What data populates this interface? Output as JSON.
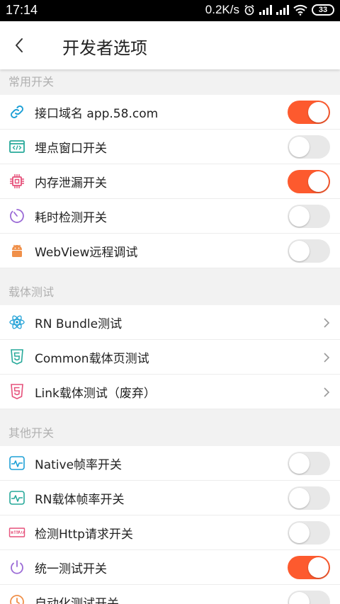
{
  "status_bar": {
    "time": "17:14",
    "network_speed": "0.2K/s",
    "battery": "33"
  },
  "header": {
    "title": "开发者选项",
    "back_icon": "chevron-left-icon"
  },
  "colors": {
    "accent": "#fd5a2e",
    "toggle_off": "#e8e8e8",
    "section_text": "#b0b0b0"
  },
  "sections": [
    {
      "title": "常用开关",
      "items": [
        {
          "label": "接口域名 app.58.com",
          "icon": "link-icon",
          "control": "toggle",
          "on": true
        },
        {
          "label": "埋点窗口开关",
          "icon": "code-window-icon",
          "control": "toggle",
          "on": false
        },
        {
          "label": "内存泄漏开关",
          "icon": "chip-icon",
          "control": "toggle",
          "on": true
        },
        {
          "label": "耗时检测开关",
          "icon": "gauge-icon",
          "control": "toggle",
          "on": false
        },
        {
          "label": "WebView远程调试",
          "icon": "android-icon",
          "control": "toggle",
          "on": false
        }
      ]
    },
    {
      "title": "载体测试",
      "items": [
        {
          "label": "RN Bundle测试",
          "icon": "react-icon",
          "control": "chevron"
        },
        {
          "label": "Common载体页测试",
          "icon": "html5-icon",
          "control": "chevron"
        },
        {
          "label": "Link载体测试（废弃）",
          "icon": "html5-red-icon",
          "control": "chevron"
        }
      ]
    },
    {
      "title": "其他开关",
      "items": [
        {
          "label": "Native帧率开关",
          "icon": "pulse-icon",
          "control": "toggle",
          "on": false
        },
        {
          "label": "RN载体帧率开关",
          "icon": "pulse-green-icon",
          "control": "toggle",
          "on": false
        },
        {
          "label": "检测Http请求开关",
          "icon": "http-icon",
          "control": "toggle",
          "on": false
        },
        {
          "label": "统一测试开关",
          "icon": "power-icon",
          "control": "toggle",
          "on": true
        },
        {
          "label": "自动化测试开关",
          "icon": "clock-icon",
          "control": "toggle",
          "on": false
        }
      ]
    }
  ]
}
